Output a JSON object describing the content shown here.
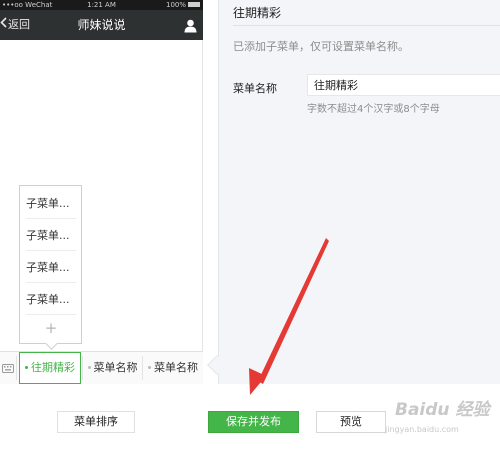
{
  "status_bar": {
    "carrier": "•••oo WeChat",
    "time": "1:21 AM",
    "battery": "100%"
  },
  "nav": {
    "back_label": "返回",
    "title": "师妹说说",
    "icons": {
      "back": "chevron-left-icon",
      "user": "user-icon"
    }
  },
  "submenu": {
    "items": [
      "子菜单...",
      "子菜单...",
      "子菜单...",
      "子菜单..."
    ],
    "add_label": "+"
  },
  "menu_bar": {
    "tabs": [
      {
        "label": "往期精彩",
        "active": true
      },
      {
        "label": "菜单名称",
        "active": false
      },
      {
        "label": "菜单名称",
        "active": false
      }
    ],
    "icons": {
      "keyboard": "keyboard-icon"
    }
  },
  "panel": {
    "title": "往期精彩",
    "tip": "已添加子菜单，仅可设置菜单名称。",
    "field_label": "菜单名称",
    "field_value": "往期精彩",
    "field_hint": "字数不超过4个汉字或8个字母"
  },
  "buttons": {
    "sort": "菜单排序",
    "publish": "保存并发布",
    "preview": "预览"
  },
  "watermark": {
    "main": "Baidu 经验",
    "sub": "jingyan.baidu.com"
  },
  "colors": {
    "accent": "#44b549",
    "nav_bg": "#2e3132",
    "panel_bg": "#f4f5f9",
    "annotation_arrow": "#e53935"
  }
}
